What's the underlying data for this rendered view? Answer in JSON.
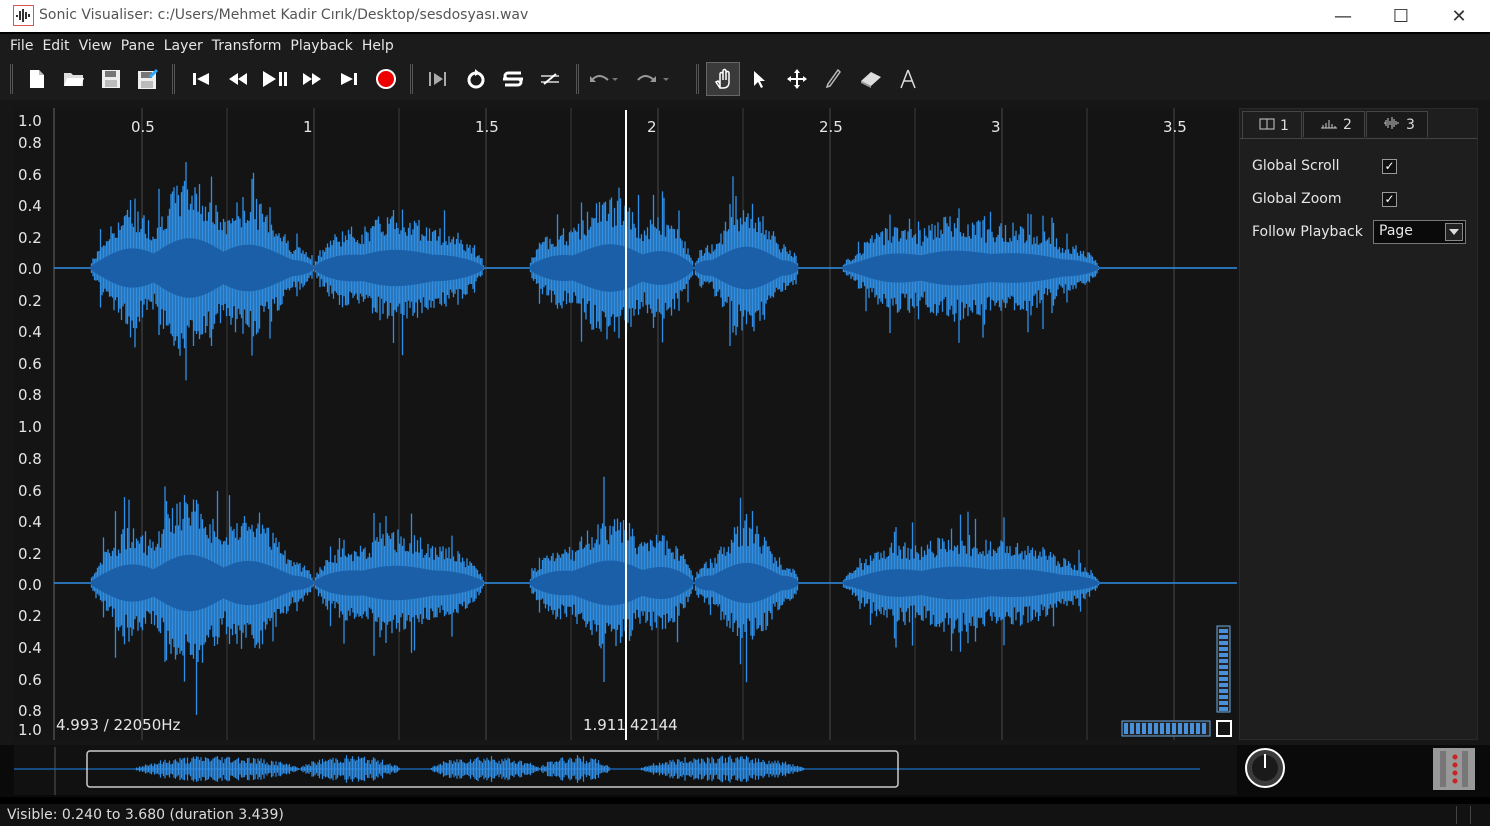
{
  "window": {
    "title": "Sonic Visualiser: c:/Users/Mehmet Kadir Cırık/Desktop/sesdosyası.wav",
    "minimize_glyph": "—",
    "maximize_glyph": "☐",
    "close_glyph": "✕"
  },
  "menu": [
    "File",
    "Edit",
    "View",
    "Pane",
    "Layer",
    "Transform",
    "Playback",
    "Help"
  ],
  "toolbar": {
    "file_tools": [
      "new-file-icon",
      "open-folder-icon",
      "save-icon",
      "save-as-icon"
    ],
    "transport_tools": [
      "rewind-start-icon",
      "rewind-icon",
      "play-pause-icon",
      "fast-forward-icon",
      "fast-forward-end-icon",
      "record-icon"
    ],
    "playback_mode_tools": [
      "play-selection-icon",
      "loop-icon",
      "solo-icon",
      "speed-icon"
    ],
    "edit_tools": [
      "undo-icon",
      "redo-icon"
    ],
    "mode_tools": [
      "navigate-hand-icon",
      "select-arrow-icon",
      "move-icon",
      "draw-pencil-icon",
      "erase-icon",
      "measure-icon"
    ]
  },
  "pane": {
    "time_ticks": [
      "0.5",
      "1",
      "1.5",
      "2",
      "2.5",
      "3",
      "3.5"
    ],
    "channel1_ylabels": [
      "1.0",
      "0.8",
      "0.6",
      "0.4",
      "0.2",
      "0.0",
      "0.2",
      "0.4",
      "0.6",
      "0.8"
    ],
    "channel2_ylabels": [
      "1.0",
      "0.8",
      "0.6",
      "0.4",
      "0.2",
      "0.0",
      "0.2",
      "0.4",
      "0.6",
      "0.8",
      "1.0"
    ],
    "duration_rate": "4.993 / 22050Hz",
    "cursor_time": "1.911",
    "cursor_frame": "42144",
    "waveform_color": "#2f8fe6",
    "waveform_dark_color": "#1b5fa8"
  },
  "panel": {
    "tabs": [
      {
        "number": "1",
        "icon": "pane-icon"
      },
      {
        "number": "2",
        "icon": "spectrum-icon"
      },
      {
        "number": "3",
        "icon": "waveform-icon"
      }
    ],
    "global_scroll_label": "Global Scroll",
    "global_scroll_checked": true,
    "global_zoom_label": "Global Zoom",
    "global_zoom_checked": true,
    "follow_playback_label": "Follow Playback",
    "follow_playback_value": "Page"
  },
  "status": {
    "text": "Visible: 0.240 to 3.680 (duration 3.439)"
  }
}
